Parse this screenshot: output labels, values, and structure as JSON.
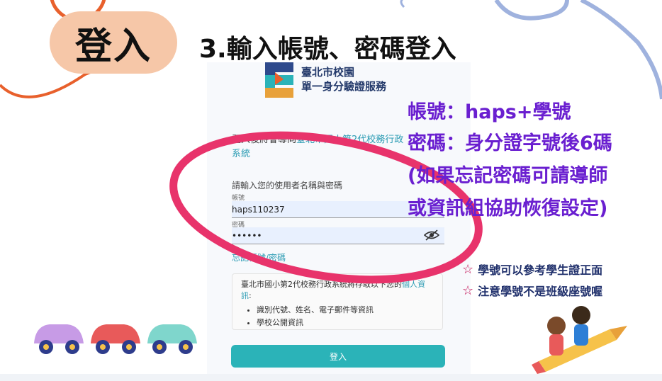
{
  "slide": {
    "badge": "登入",
    "title": "3.輸入帳號、密碼登入"
  },
  "brand": {
    "line1": "臺北市校園",
    "line2": "單一身分驗證服務"
  },
  "login_form": {
    "redirect_prefix": "登入後將會導向",
    "redirect_link": "臺北市國小第2代校務行政",
    "redirect_line2": "系統",
    "prompt": "請輸入您的使用者名稱與密碼",
    "account_label": "帳號",
    "account_value": "haps110237",
    "password_label": "密碼",
    "password_value": "••••••",
    "forgot": "忘記帳號/密碼",
    "info_prefix": "臺北市國小第2代校務行政系統將存取以下您的",
    "info_link": "個人資訊",
    "info_suffix": ":",
    "info_items": [
      "識別代號、姓名、電子郵件等資訊",
      "學校公開資訊"
    ],
    "login_button": "登入"
  },
  "annotations": {
    "line1": "帳號：haps+學號",
    "line2": "密碼：身分證字號後6碼",
    "line3": "(如果忘記密碼可請導師",
    "line4": "或資訊組協助恢復設定)"
  },
  "notes": {
    "note1": "學號可以參考學生證正面",
    "note2": "注意學號不是班級座號喔"
  },
  "icons": {
    "star": "star-icon",
    "eye": "eye-slash-icon",
    "logo": "school-logo-icon"
  },
  "colors": {
    "badge_bg": "#f6c7a8",
    "annotation": "#6a1fd0",
    "highlight_ellipse": "#e8336b",
    "button": "#2bb3b8",
    "link": "#2a9bb3"
  }
}
